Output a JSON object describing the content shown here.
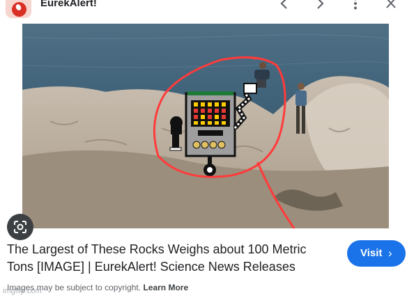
{
  "topbar": {
    "site_name": "EurekAlert!",
    "logo_icon": "eurekalert-logo",
    "actions": [
      "chevron-left-icon",
      "chevron-right-icon",
      "more-vert-icon",
      "close-icon"
    ]
  },
  "image": {
    "lens_icon": "google-lens-icon"
  },
  "result": {
    "title": "The Largest of These Rocks Weighs about 100 Metric Tons [IMAGE] | EurekAlert! Science News Releases",
    "visit_label": "Visit",
    "visit_chevron": "›"
  },
  "footer": {
    "notice": "Images may be subject to copyright.",
    "learn_more": "Learn More",
    "watermark": "imgflip.com"
  },
  "colors": {
    "accent": "#1a73e8",
    "annotation_red": "#ff3b3b",
    "logo_red": "#d93025"
  }
}
